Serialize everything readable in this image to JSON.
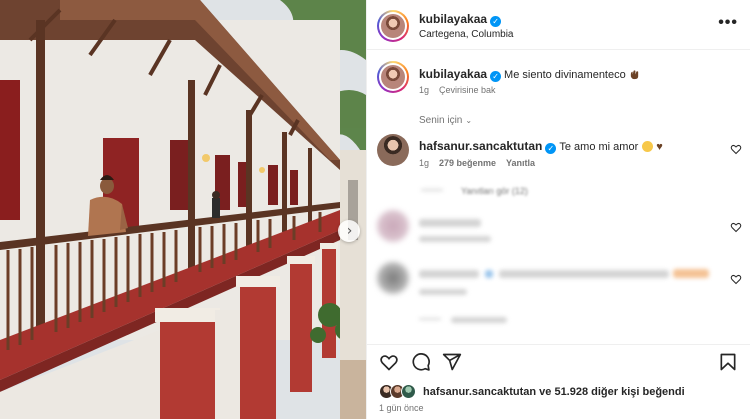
{
  "post": {
    "author": "kubilayakaa",
    "location": "Cartegena, Columbia",
    "more_label": "•••"
  },
  "caption": {
    "username": "kubilayakaa",
    "text": "Me siento divinamenteco",
    "age": "1g",
    "translate": "Çevirisine bak"
  },
  "comments": {
    "sort_label": "Senin için",
    "pinned": {
      "username": "hafsanur.sancaktutan",
      "text": "Te amo mi amor",
      "age": "1g",
      "likes": "279 beğenme",
      "reply": "Yanıtla"
    },
    "view_replies": "Yanıtları gör (12)"
  },
  "likes": {
    "first_liker": "hafsanur.sancaktutan",
    "rest": "ve 51.928 diğer kişi beğendi"
  },
  "timestamp": "1 gün önce",
  "colors": {
    "verified": "#0095f6",
    "secondary_text": "#737373",
    "brown_heart": "#6b4226"
  },
  "icons": [
    "more-options-icon",
    "verified-icon",
    "heart-icon",
    "comment-icon",
    "share-icon",
    "bookmark-icon",
    "carousel-next-icon"
  ]
}
